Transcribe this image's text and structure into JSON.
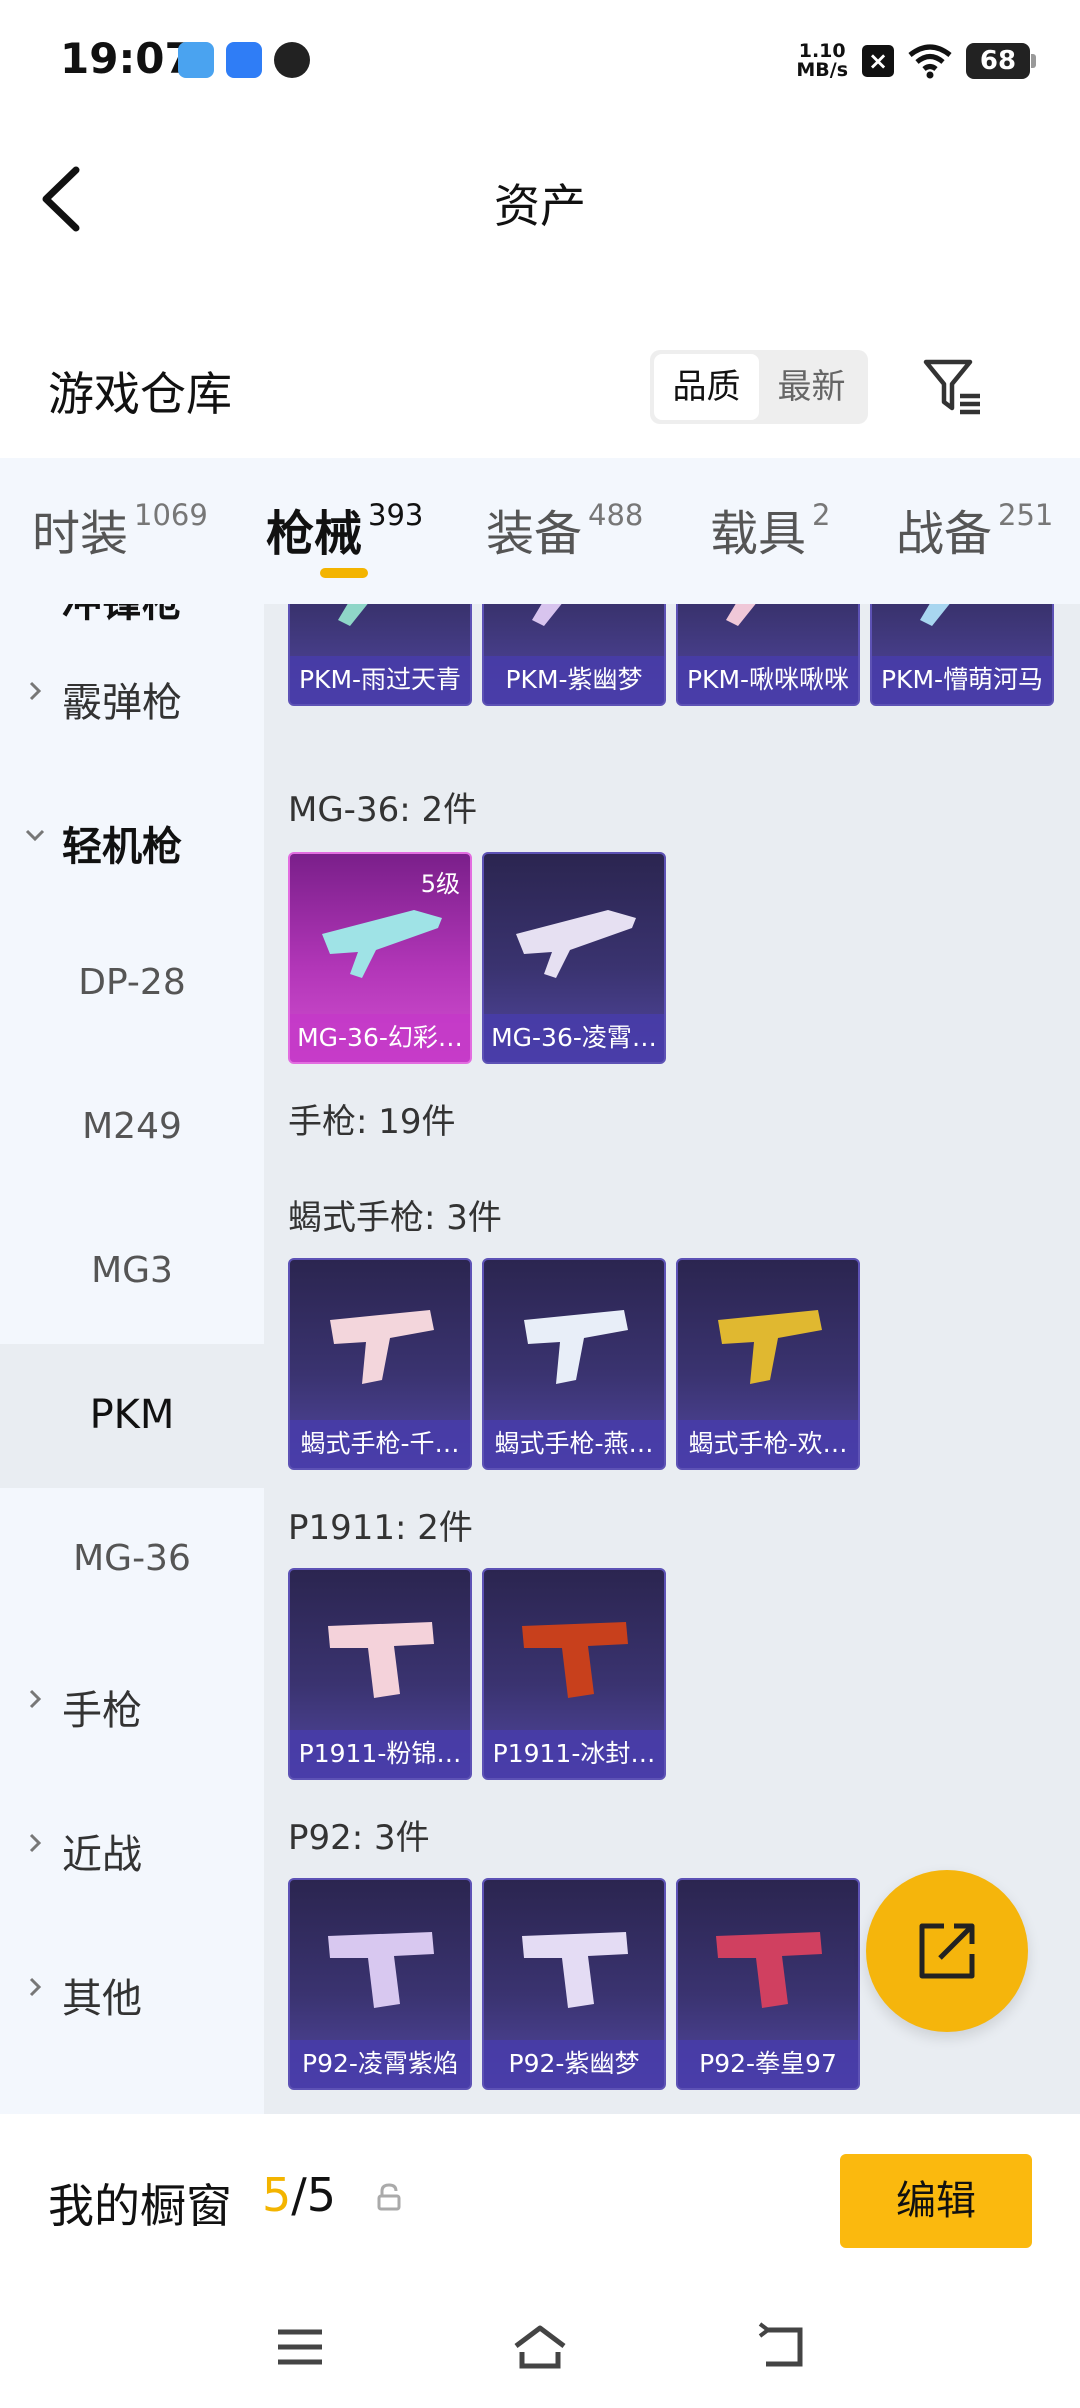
{
  "status_bar": {
    "time": "19:07",
    "net_speed_value": "1.10",
    "net_speed_unit": "MB/s",
    "battery": "68"
  },
  "header": {
    "title": "资产",
    "back_icon": "chevron-left-icon"
  },
  "warehouse": {
    "title": "游戏仓库",
    "sort_options": [
      "品质",
      "最新"
    ],
    "active_sort": "品质",
    "filter_icon": "filter-icon"
  },
  "tabs": [
    {
      "label": "时装",
      "count": "1069"
    },
    {
      "label": "枪械",
      "count": "393"
    },
    {
      "label": "装备",
      "count": "488"
    },
    {
      "label": "载具",
      "count": "2"
    },
    {
      "label": "战备",
      "count": "251"
    }
  ],
  "active_tab": "枪械",
  "sidebar": {
    "items": [
      {
        "label": "冲锋枪"
      },
      {
        "label": "霰弹枪"
      },
      {
        "label": "轻机枪"
      },
      {
        "label": "DP-28"
      },
      {
        "label": "M249"
      },
      {
        "label": "MG3"
      },
      {
        "label": "PKM"
      },
      {
        "label": "MG-36"
      },
      {
        "label": "手枪"
      },
      {
        "label": "近战"
      },
      {
        "label": "其他"
      }
    ],
    "selected": "PKM"
  },
  "sections": {
    "pkm_cards": [
      "PKM-雨过天青",
      "PKM-紫幽梦",
      "PKM-啾咪啾咪",
      "PKM-懵萌河马"
    ],
    "mg36_title": "MG-36: 2件",
    "mg36_cards": [
      "MG-36-幻彩…",
      "MG-36-凌霄…"
    ],
    "mg36_level": "5级",
    "pistol_title": "手枪: 19件",
    "scorpion_title": "蝎式手枪: 3件",
    "scorpion_cards": [
      "蝎式手枪-千…",
      "蝎式手枪-燕…",
      "蝎式手枪-欢…"
    ],
    "p1911_title": "P1911: 2件",
    "p1911_cards": [
      "P1911-粉锦…",
      "P1911-冰封…"
    ],
    "p92_title": "P92: 3件",
    "p92_cards": [
      "P92-凌霄紫焰",
      "P92-紫幽梦",
      "P92-拳皇97"
    ]
  },
  "showcase": {
    "title": "我的橱窗",
    "count_current": "5",
    "count_sep": "/",
    "count_total": "5",
    "edit_label": "编辑"
  },
  "colors": {
    "accent": "#f3b400",
    "card_purple": "#3a3370",
    "card_pink": "#b236b8",
    "tab_bg": "#f3f7fd",
    "content_bg": "#e9edf2"
  }
}
